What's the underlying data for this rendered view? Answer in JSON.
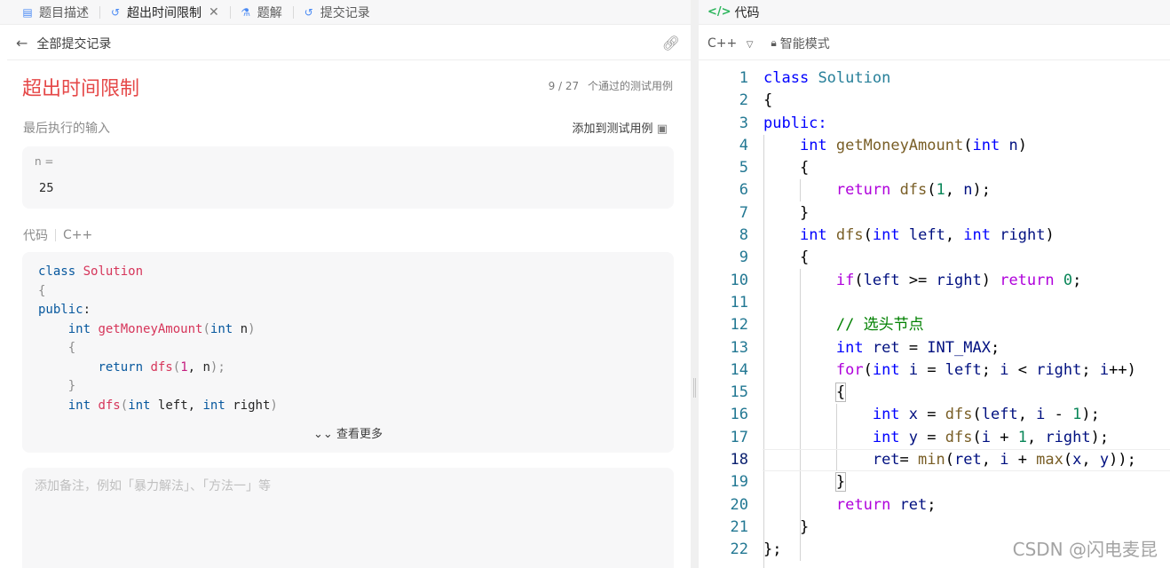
{
  "tabs": [
    {
      "label": "题目描述",
      "icon": "doc-icon"
    },
    {
      "label": "超出时间限制",
      "icon": "history-icon"
    },
    {
      "label": "题解",
      "icon": "flask-icon"
    },
    {
      "label": "提交记录",
      "icon": "history-icon"
    }
  ],
  "subheader": {
    "back_label": "全部提交记录"
  },
  "result": {
    "status": "超出时间限制",
    "passed_count": "9 / 27",
    "passed_text": "个通过的测试用例",
    "last_input_label": "最后执行的输入",
    "add_testcase_label": "添加到测试用例",
    "input_name": "n =",
    "input_value": "25"
  },
  "code_section": {
    "label": "代码",
    "language": "C++",
    "view_more_label": "查看更多"
  },
  "notes": {
    "placeholder": "添加备注，例如「暴力解法」、「方法一」等"
  },
  "editor": {
    "tab_label": "代码",
    "language": "C++",
    "mode_label": "智能模式",
    "current_line": 18
  },
  "watermark": "CSDN @闪电麦昆",
  "colors": {
    "status_red": "#e54848",
    "accent_green": "#2db55d"
  }
}
